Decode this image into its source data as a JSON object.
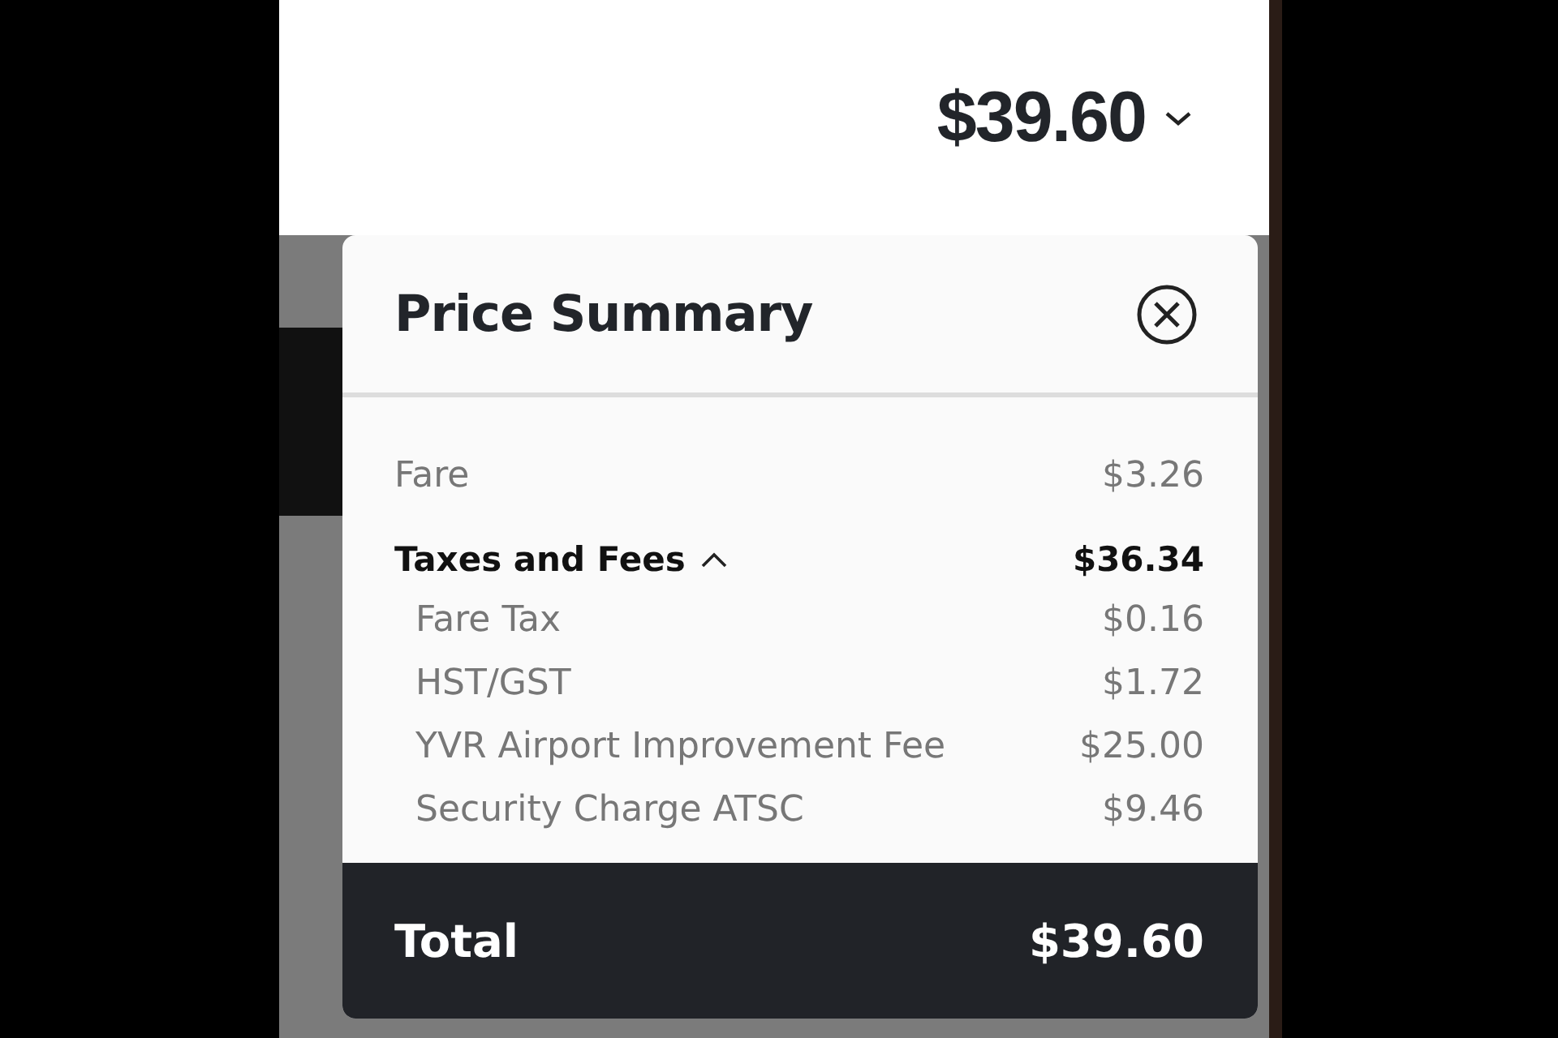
{
  "header": {
    "price": "$39.60"
  },
  "price_summary": {
    "title": "Price Summary",
    "items": [
      {
        "kind": "line",
        "label": "Fare",
        "amount": "$3.26"
      },
      {
        "kind": "group",
        "label": "Taxes and Fees",
        "amount": "$36.34",
        "expanded": true,
        "children": [
          {
            "label": "Fare Tax",
            "amount": "$0.16"
          },
          {
            "label": "HST/GST",
            "amount": "$1.72"
          },
          {
            "label": "YVR Airport Improvement Fee",
            "amount": "$25.00"
          },
          {
            "label": "Security Charge ATSC",
            "amount": "$9.46"
          }
        ]
      }
    ],
    "total": {
      "label": "Total",
      "amount": "$39.60"
    }
  }
}
